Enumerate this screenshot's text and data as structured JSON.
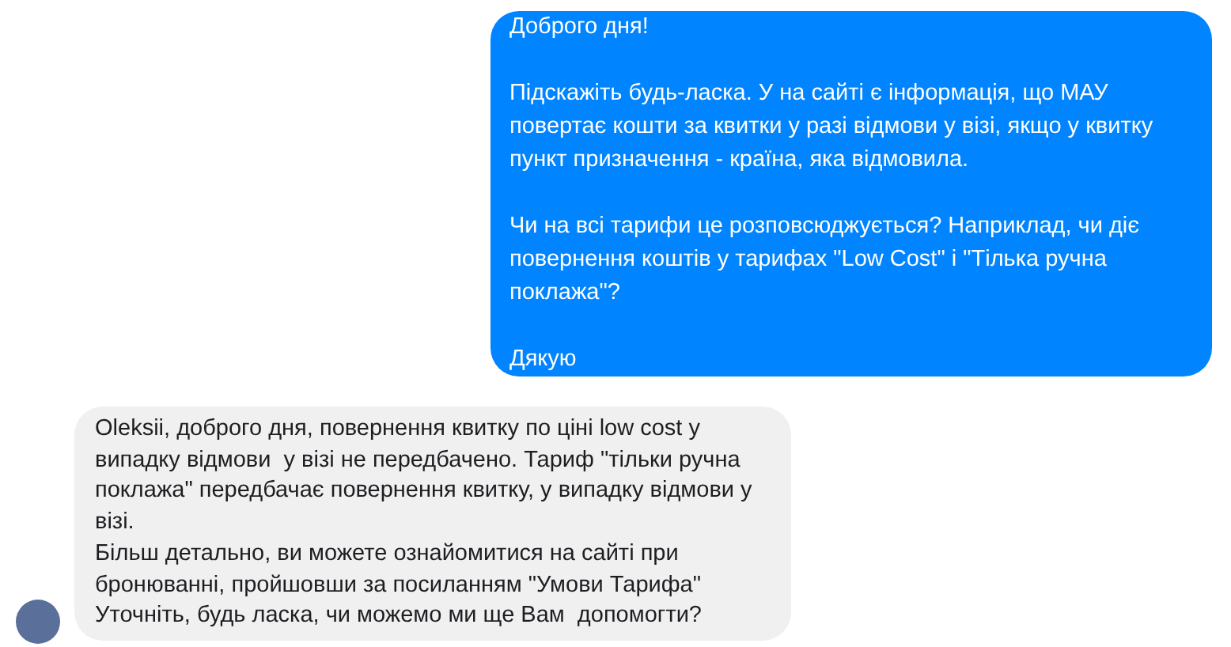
{
  "messages": [
    {
      "kind": "outgoing",
      "paragraphs": [
        "Доброго дня!",
        "Підскажіть будь-ласка. У на сайті є інформація, що МАУ повертає кошти за квитки у разі відмови у візі, якщо у квитку пункт призначення - країна, яка відмовила.",
        "Чи на всі тарифи це розповсюджується? Наприклад, чи діє повернення коштів у тарифах \"Low Cost\" і \"Тілька ручна поклажа\"?",
        "Дякую"
      ]
    },
    {
      "kind": "incoming",
      "paragraphs": [
        "Oleksii, доброго дня, повернення квитку по ціні low cost у випадку відмови  у візі не передбачено. Тариф \"тільки ручна поклажа\" передбачає повернення квитку, у випадку відмови у візі.",
        "Більш детально, ви можете ознайомитися на сайті при бронюванні, пройшовши за посиланням \"Умови Тарифа\"",
        "Уточніть, будь ласка, чи можемо ми ще Вам  допомогти?"
      ]
    }
  ]
}
